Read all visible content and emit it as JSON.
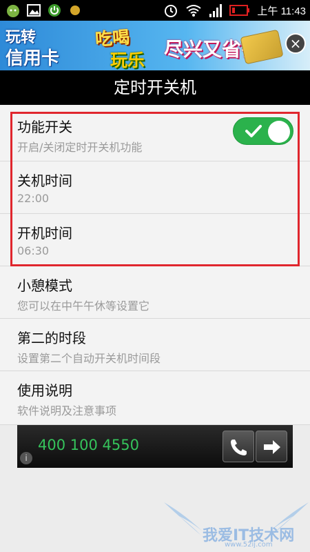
{
  "status_bar": {
    "time": "上午 11:43",
    "left_icons": [
      "android-face-icon",
      "image-icon",
      "power-icon",
      "coin-icon"
    ],
    "right_icons": [
      "alarm-icon",
      "wifi-icon",
      "signal-icon",
      "battery-icon"
    ]
  },
  "ad_banner": {
    "line1": "玩转",
    "line2": "信用卡",
    "word3": "吃喝",
    "word4": "玩乐",
    "word5": "尽兴又省钱",
    "close_label": "×"
  },
  "header": {
    "title": "定时开关机"
  },
  "settings": [
    {
      "title": "功能开关",
      "subtitle": "开启/关闭定时开关机功能",
      "toggle_on": true
    },
    {
      "title": "关机时间",
      "subtitle": "22:00"
    },
    {
      "title": "开机时间",
      "subtitle": "06:30"
    },
    {
      "title": "小憩模式",
      "subtitle": "您可以在中午午休等设置它"
    },
    {
      "title": "第二的时段",
      "subtitle": "设置第二个自动开关机时间段"
    },
    {
      "title": "使用说明",
      "subtitle": "软件说明及注意事项"
    }
  ],
  "bottom_ad": {
    "phone": "400 100 4550",
    "info_label": "i"
  },
  "watermark": {
    "text": "我爱IT技术网",
    "url": "www.52ij.com"
  },
  "colors": {
    "toggle_on": "#2bb24c",
    "highlight": "#e0262d",
    "phone_text": "#35c35b"
  }
}
